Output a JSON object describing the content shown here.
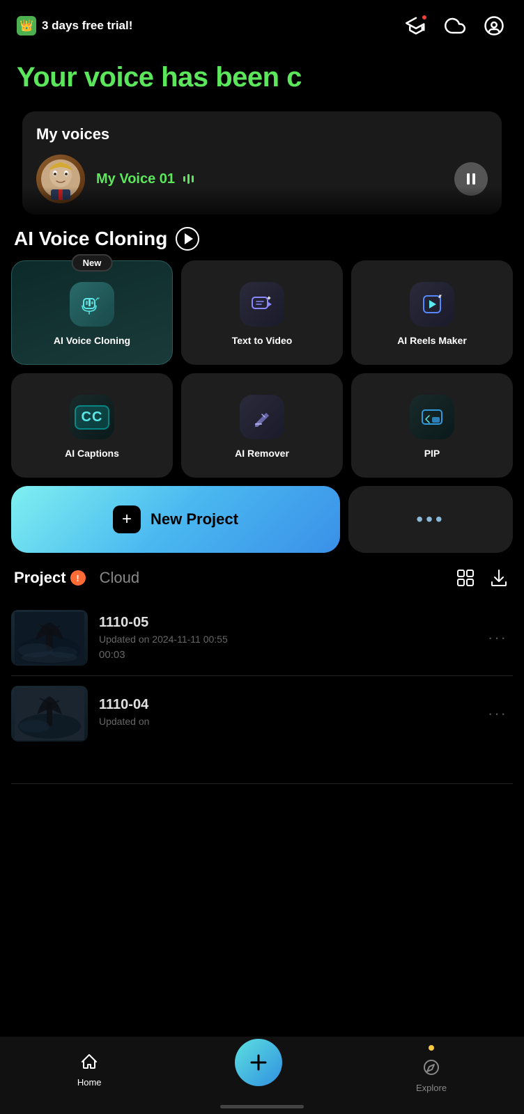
{
  "topBar": {
    "trialLabel": "3 days free trial!",
    "icons": [
      "graduate-cap-icon",
      "cloud-icon",
      "user-circle-icon"
    ]
  },
  "hero": {
    "title": "Your voice has been c"
  },
  "myVoices": {
    "title": "My voices",
    "voiceName": "My Voice 01",
    "voiceAvatar": "👤"
  },
  "aiVoiceCloning": {
    "title": "AI Voice Cloning"
  },
  "tools": [
    {
      "label": "AI Voice Cloning",
      "badge": "New",
      "active": true
    },
    {
      "label": "Text  to Video",
      "badge": "",
      "active": false
    },
    {
      "label": "AI Reels Maker",
      "badge": "",
      "active": false
    },
    {
      "label": "AI Captions",
      "badge": "",
      "active": false
    },
    {
      "label": "AI Remover",
      "badge": "",
      "active": false
    },
    {
      "label": "PIP",
      "badge": "",
      "active": false
    }
  ],
  "newProject": {
    "label": "New Project",
    "moreLabel": "..."
  },
  "projectSection": {
    "tab1": "Project",
    "tab2": "Cloud",
    "items": [
      {
        "name": "1110-05",
        "date": "Updated on 2024-11-11 00:55",
        "duration": "00:03"
      },
      {
        "name": "1110-04",
        "date": "Updated on",
        "duration": ""
      }
    ]
  },
  "bottomNav": {
    "homeLabel": "Home",
    "exploreLabel": "Explore"
  }
}
